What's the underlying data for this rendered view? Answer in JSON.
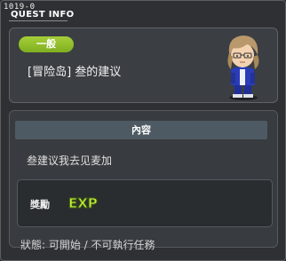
{
  "window": {
    "quest_id": "1019-0",
    "title": "QUEST INFO"
  },
  "quest": {
    "category_badge": "一般",
    "name": "[冒险岛] 叁的建议"
  },
  "content": {
    "header": "內容",
    "description": "叁建议我去见麦加"
  },
  "reward": {
    "label": "獎勵",
    "icon": "exp-icon",
    "icon_text": "EXP"
  },
  "status_line": "狀態: 可開始 / 不可執行任務",
  "colors": {
    "badge": "#95c22c",
    "background": "#2e3033",
    "header": "#4e5a63"
  }
}
